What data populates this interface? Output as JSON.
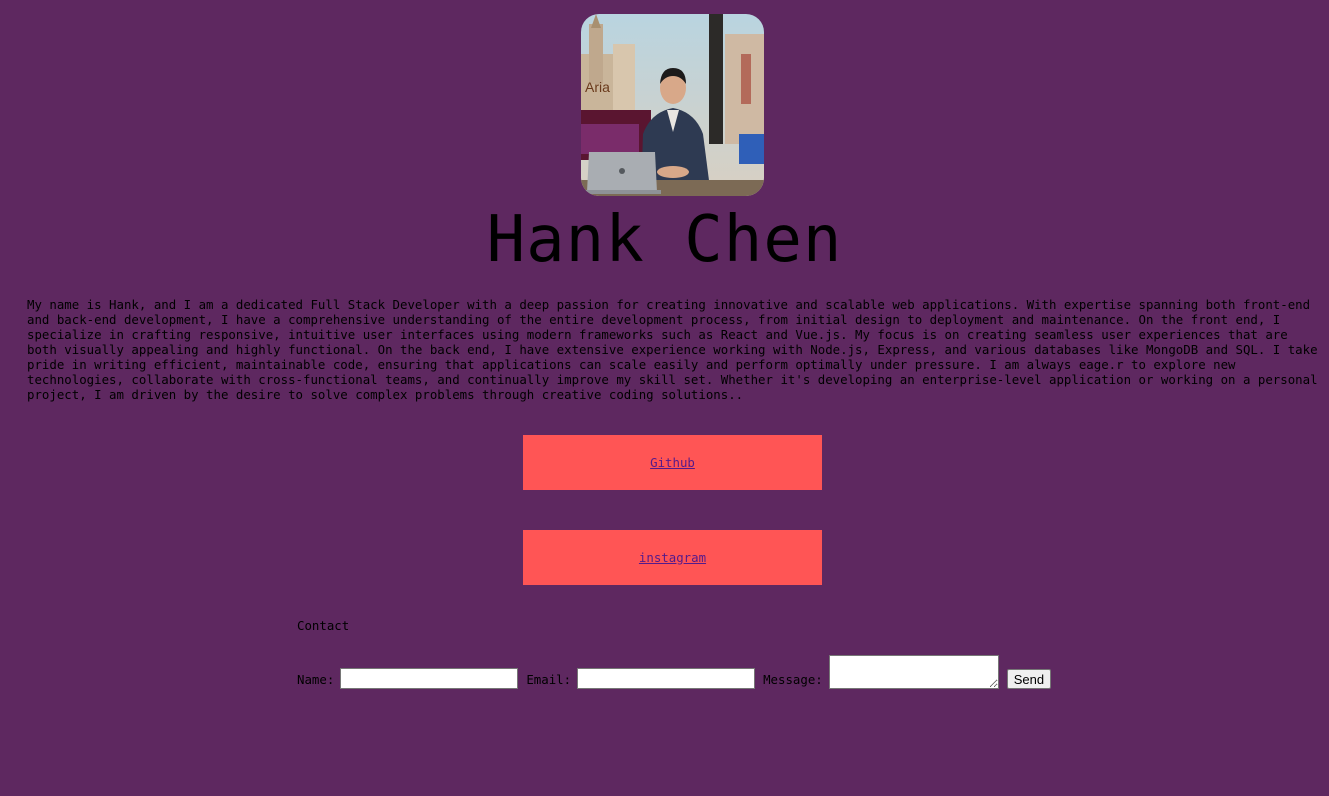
{
  "profile": {
    "name": "Hank Chen",
    "bio": "My name is Hank, and I am a dedicated Full Stack Developer with a deep passion for creating innovative and scalable web applications. With expertise spanning both front-end and back-end development, I have a comprehensive understanding of the entire development process, from initial design to deployment and maintenance. On the front end, I specialize in crafting responsive, intuitive user interfaces using modern frameworks such as React and Vue.js. My focus is on creating seamless user experiences that are both visually appealing and highly functional. On the back end, I have extensive experience working with Node.js, Express, and various databases like MongoDB and SQL. I take pride in writing efficient, maintainable code, ensuring that applications can scale easily and perform optimally under pressure. I am always eage.r to explore new technologies, collaborate with cross-functional teams, and continually improve my skill set. Whether it's developing an enterprise-level application or working on a personal project, I am driven by the desire to solve complex problems through creative coding solutions..",
    "photo_icon": "profile-photo"
  },
  "links": {
    "github_label": "Github",
    "instagram_label": "instagram"
  },
  "contact": {
    "title": "Contact",
    "name_label": "Name:",
    "name_value": "",
    "email_label": "Email:",
    "email_value": "",
    "message_label": "Message:",
    "message_value": "",
    "send_label": "Send"
  },
  "colors": {
    "background": "#5e2860",
    "link_box": "#ff5555",
    "link_text": "#551a8b"
  }
}
